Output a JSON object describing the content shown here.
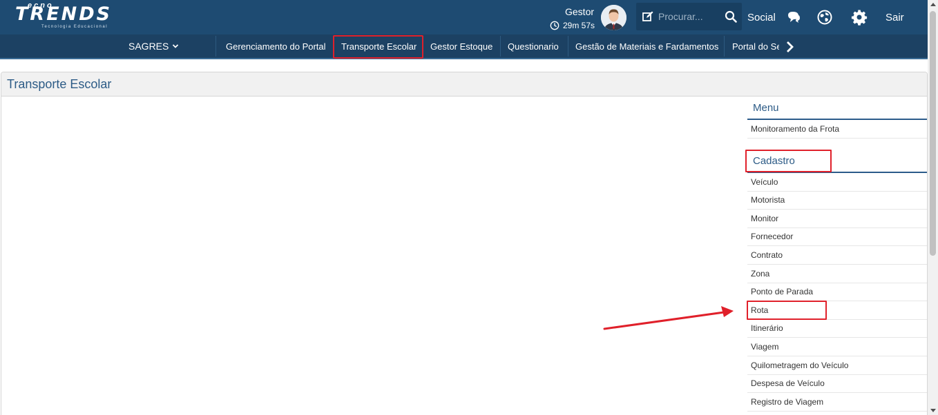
{
  "header": {
    "logo_top": "ecno",
    "logo_main": "TRENDS",
    "logo_sub": "Tecnologia Educacional",
    "user_name": "Gestor",
    "session_timer": "29m 57s",
    "search_placeholder": "Procurar...",
    "social_label": "Social",
    "logout_label": "Sair",
    "icons": [
      "clock-icon",
      "avatar",
      "edit-icon",
      "search-icon",
      "chat-icon",
      "globe-icon",
      "gear-icon"
    ]
  },
  "nav": {
    "items": [
      {
        "label": "SAGRES"
      },
      {
        "label": "Gerenciamento do Portal"
      },
      {
        "label": "Transporte Escolar"
      },
      {
        "label": "Gestor Estoque"
      },
      {
        "label": "Questionario"
      },
      {
        "label": "Gestão de Materiais e Fardamentos"
      },
      {
        "label": "Portal do Se"
      }
    ],
    "active": "Transporte Escolar"
  },
  "panel": {
    "title": "Transporte Escolar"
  },
  "side_menu": {
    "menu_heading": "Menu",
    "menu_items": [
      "Monitoramento da Frota"
    ],
    "cadastro_heading": "Cadastro",
    "cadastro_items": [
      "Veículo",
      "Motorista",
      "Monitor",
      "Fornecedor",
      "Contrato",
      "Zona",
      "Ponto de Parada",
      "Rota",
      "Itinerário",
      "Viagem",
      "Quilometragem do Veículo",
      "Despesa de Veículo",
      "Registro de Viagem"
    ]
  },
  "colors": {
    "header_bg": "#1e4b72",
    "nav_bg": "#1c4163",
    "highlight": "#e0202a",
    "title_blue": "#2c5b86"
  }
}
